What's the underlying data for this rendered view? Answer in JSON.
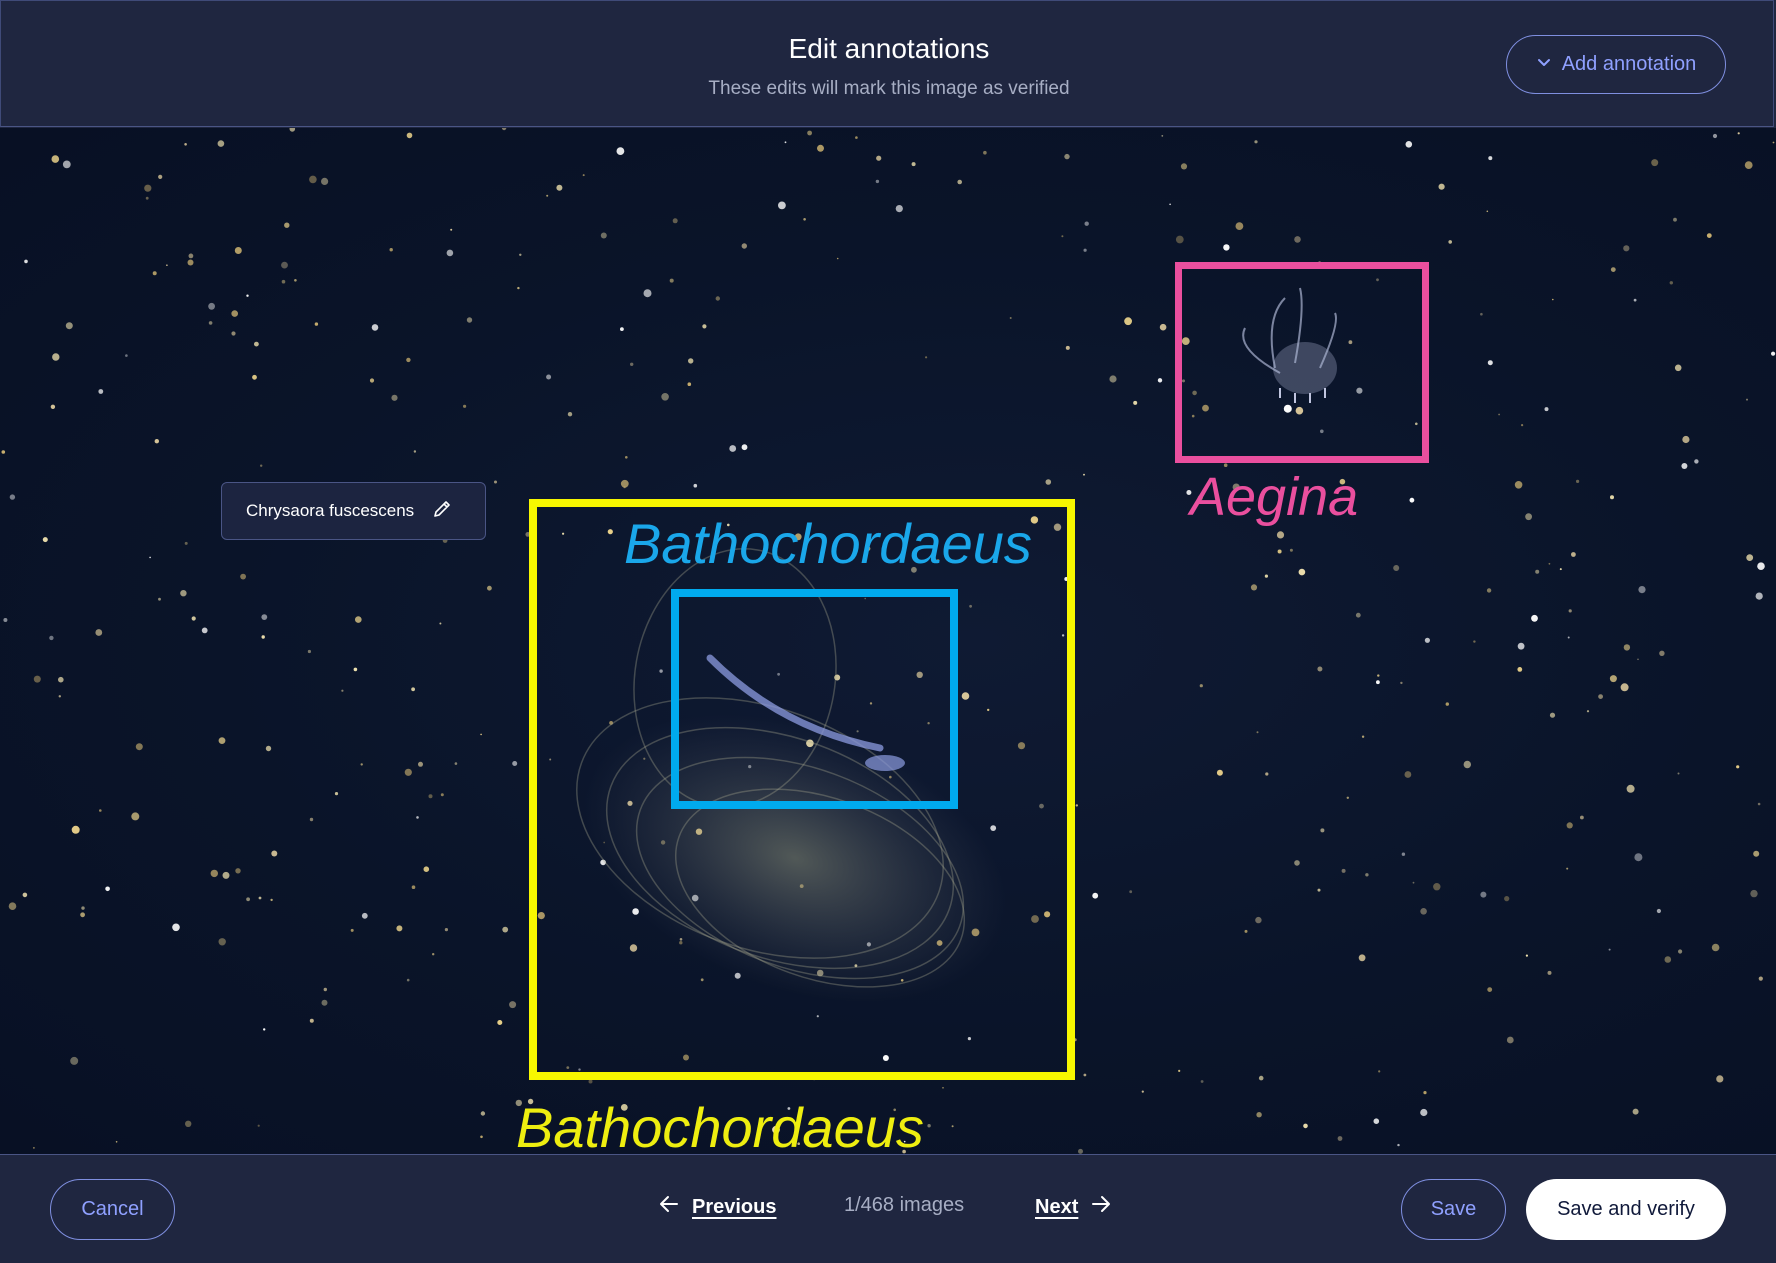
{
  "header": {
    "title": "Edit annotations",
    "subtitle": "These edits will mark this image as verified",
    "add_annotation_label": "Add annotation",
    "add_annotation_icon": "chevron-down-icon"
  },
  "image": {
    "annotation_chip": {
      "label": "Chrysaora fuscescens",
      "icon": "pencil-icon"
    },
    "annotations": [
      {
        "label": "Bathochordaeus",
        "color": "#f7f700"
      },
      {
        "label": "Bathochordaeus",
        "color": "#00aaee"
      },
      {
        "label": "Aegina",
        "color": "#ea4f9e"
      }
    ]
  },
  "footer": {
    "cancel_label": "Cancel",
    "previous_label": "Previous",
    "counter": "1/468 images",
    "next_label": "Next",
    "save_label": "Save",
    "save_verify_label": "Save and verify"
  },
  "colors": {
    "accent": "#8fa0ff",
    "background": "#1f2640"
  }
}
